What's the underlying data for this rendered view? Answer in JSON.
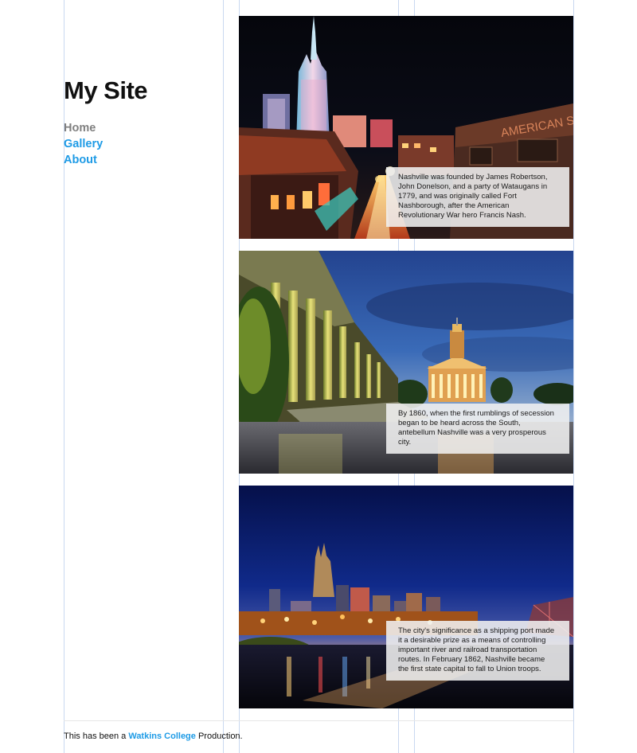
{
  "site": {
    "title": "My Site"
  },
  "nav": {
    "items": [
      {
        "label": "Home",
        "state": "current"
      },
      {
        "label": "Gallery",
        "state": "link"
      },
      {
        "label": "About",
        "state": "link"
      }
    ]
  },
  "gallery": {
    "items": [
      {
        "image": "nashville-broadway-night-street",
        "caption": "Nashville was founded by James Robertson, John Donelson, and a party of Wataugans in 1779, and was originally called Fort Nashborough, after the American Revolutionary War hero Francis Nash."
      },
      {
        "image": "tennessee-state-capitol-dusk",
        "caption": "By 1860, when the first rumblings of secession began to be heard across the South, antebellum Nashville was a very prosperous city."
      },
      {
        "image": "nashville-skyline-riverfront-night",
        "caption": "The city's significance as a shipping port made it a desirable prize as a means of controlling important river and railroad transportation routes. In February 1862, Nashville became the first state capital to fall to Union troops."
      }
    ]
  },
  "footer": {
    "prefix": "This has been a ",
    "link_label": "Watkins College",
    "suffix": " Production."
  },
  "colors": {
    "link": "#1e9be6",
    "current_nav": "#808080",
    "grid_guide": "#c9d8f0"
  }
}
